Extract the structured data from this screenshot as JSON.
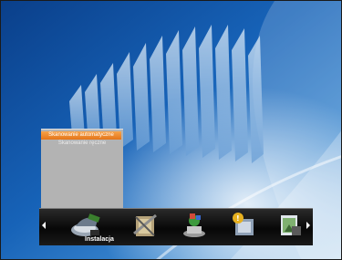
{
  "side_menu": {
    "items": [
      {
        "label": "Skanowanie automatyczne",
        "active": true
      },
      {
        "label": "Skanowanie ręczne",
        "active": false
      }
    ]
  },
  "main_menu": {
    "selected_label": "Instalacja",
    "icons": [
      "installation-dish-icon",
      "tools-icon",
      "globe-icon",
      "info-icon",
      "media-icon"
    ]
  },
  "colors": {
    "accent": "#e97f1f",
    "menu_bar": "#0a0a0a",
    "submenu_bg": "#b3b3b3",
    "background": "#0b4e98"
  }
}
